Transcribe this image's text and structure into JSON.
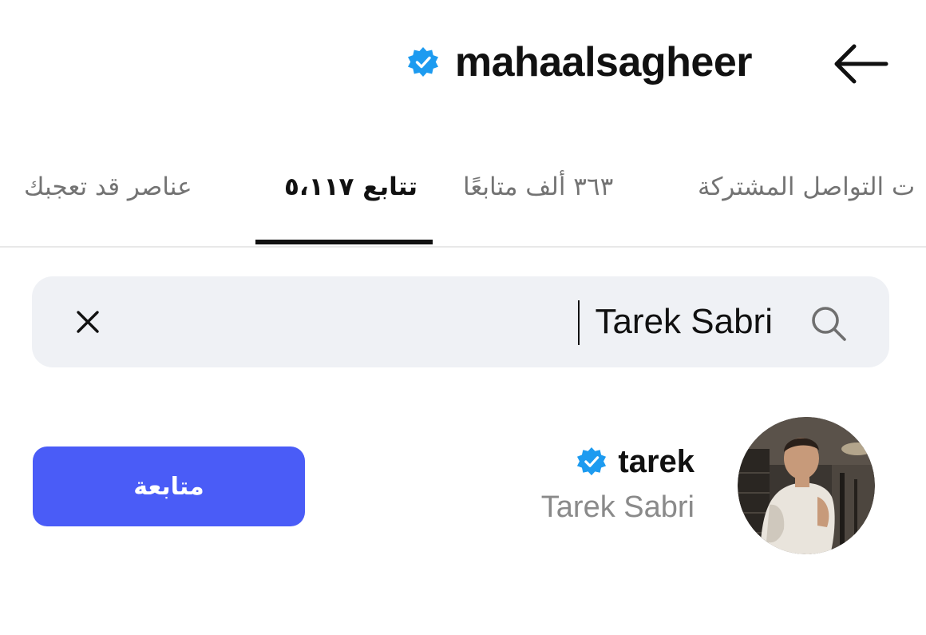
{
  "header": {
    "title": "mahaalsagheer",
    "verified_icon": "verified-badge-icon",
    "back_icon": "arrow-left-icon"
  },
  "tabs": [
    {
      "label": "عناصر قد تعجبك",
      "active": false
    },
    {
      "label": "تتابع ٥،١١٧",
      "active": true
    },
    {
      "label": "٣٦٣ ألف متابعًا",
      "active": false
    },
    {
      "label": "ت التواصل المشتركة",
      "active": false
    }
  ],
  "search": {
    "value": "Tarek Sabri",
    "placeholder": "",
    "search_icon": "search-icon",
    "clear_icon": "close-icon"
  },
  "results": [
    {
      "username": "tarek",
      "full_name": "Tarek Sabri",
      "verified": true,
      "follow_label": "متابعة"
    }
  ],
  "colors": {
    "accent": "#4a5cf7",
    "verified": "#1d9bf0",
    "search_bg": "#eff1f5",
    "muted_text": "#737373"
  }
}
